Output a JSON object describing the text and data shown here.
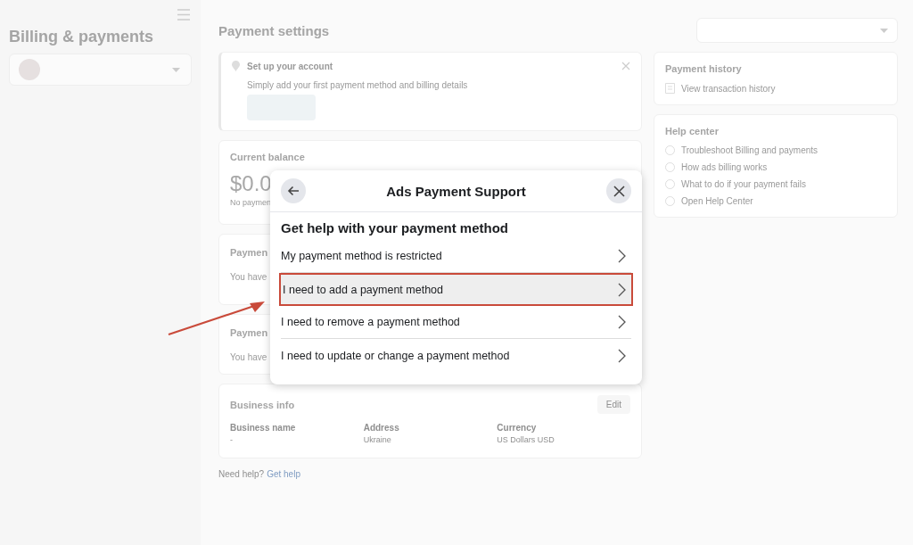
{
  "sidebar": {
    "title": "Billing & payments"
  },
  "page_title": "Payment settings",
  "setup_card": {
    "title": "Set up your account",
    "text": "Simply add your first payment method and billing details"
  },
  "balance_card": {
    "title": "Current balance",
    "amount": "$0.0",
    "note": "No paymen"
  },
  "payment_cards": [
    {
      "title": "Paymen",
      "text": "You have"
    },
    {
      "title": "Paymen",
      "text": "You have"
    }
  ],
  "business_info": {
    "title": "Business info",
    "edit": "Edit",
    "fields": [
      {
        "label": "Business name",
        "value": "-"
      },
      {
        "label": "Address",
        "value": "Ukraine"
      },
      {
        "label": "Currency",
        "value": "US Dollars USD"
      }
    ]
  },
  "help_prompt": {
    "text": "Need help?",
    "link": "Get help"
  },
  "payment_history": {
    "title": "Payment history",
    "link": "View transaction history"
  },
  "help_center": {
    "title": "Help center",
    "links": [
      "Troubleshoot Billing and payments",
      "How ads billing works",
      "What to do if your payment fails",
      "Open Help Center"
    ]
  },
  "modal": {
    "title": "Ads Payment Support",
    "heading": "Get help with your payment method",
    "options": [
      {
        "label": "My payment method is restricted",
        "selected": false
      },
      {
        "label": "I need to add a payment method",
        "selected": true
      },
      {
        "label": "I need to remove a payment method",
        "selected": false
      },
      {
        "label": "I need to update or change a payment method",
        "selected": false
      }
    ]
  }
}
